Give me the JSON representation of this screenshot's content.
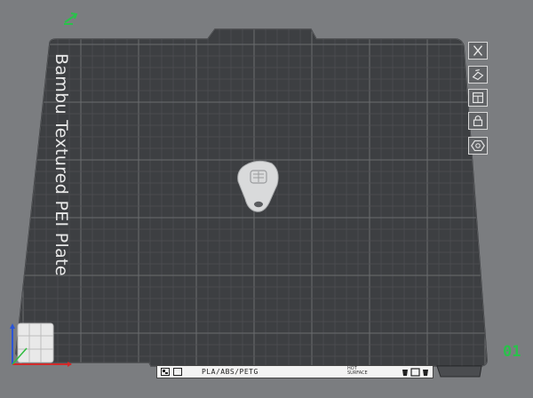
{
  "plate": {
    "name": "Bambu Textured PEI Plate",
    "number": "01"
  },
  "bottom_bar": {
    "materials": "PLA/ABS/PETG",
    "hot_surface_line1": "HOT",
    "hot_surface_line2": "SURFACE"
  },
  "toolbar": {
    "items": [
      {
        "icon": "close-icon"
      },
      {
        "icon": "auto-orient-icon"
      },
      {
        "icon": "arrange-icon"
      },
      {
        "icon": "lock-icon"
      },
      {
        "icon": "settings-icon"
      }
    ]
  },
  "colors": {
    "background": "#7b7d80",
    "plate": "#3d3f42",
    "grid_minor": "#4f5154",
    "grid_major": "#6a6c6f",
    "accent_green": "#29c24a",
    "axis_x": "#d22a2a",
    "axis_y": "#2ebc3e",
    "axis_z": "#2b55d8"
  }
}
